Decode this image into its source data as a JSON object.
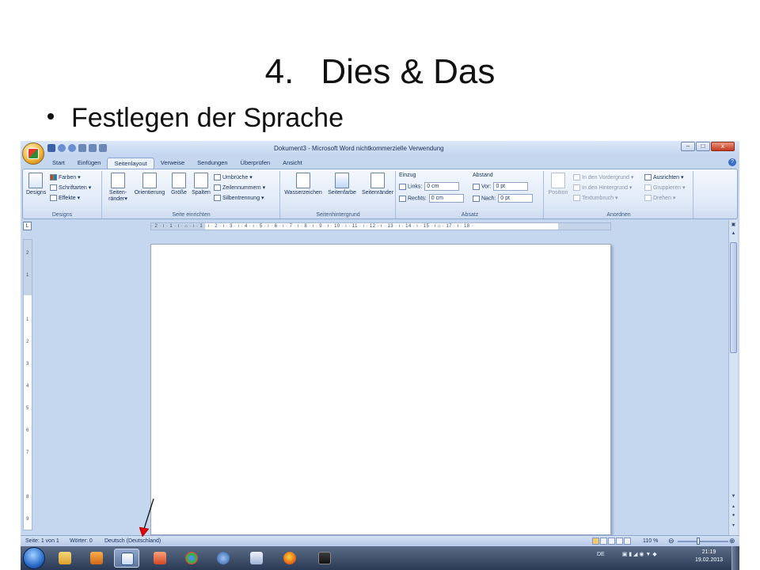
{
  "slide": {
    "title_num": "4.",
    "title_text": "Dies & Das",
    "bullet": "Festlegen der Sprache"
  },
  "window": {
    "title": "Dokument3 - Microsoft Word nichtkommerzielle Verwendung",
    "min": "–",
    "max": "□",
    "close": "x"
  },
  "tabs": [
    "Start",
    "Einfügen",
    "Seitenlayout",
    "Verweise",
    "Sendungen",
    "Überprüfen",
    "Ansicht"
  ],
  "ribbon": {
    "designs": {
      "label": "Designs",
      "designs_btn": "Designs",
      "farben": "Farben",
      "schriftarten": "Schriftarten",
      "effekte": "Effekte"
    },
    "seite_einrichten": {
      "label": "Seite einrichten",
      "seitenraender": "Seiten-",
      "seitenraender2": "ränder",
      "orientierung": "Orientierung",
      "groesse": "Größe",
      "spalten": "Spalten",
      "umbrueche": "Umbrüche",
      "zeilennummern": "Zeilennummern",
      "silbentrennung": "Silbentrennung"
    },
    "seitenhintergrund": {
      "label": "Seitenhintergrund",
      "wasserzeichen": "Wasserzeichen",
      "seitenfarbe": "Seitenfarbe",
      "seitenraender": "Seitenränder"
    },
    "absatz": {
      "label": "Absatz",
      "einzug": "Einzug",
      "links": "Links:",
      "links_val": "0 cm",
      "rechts": "Rechts:",
      "rechts_val": "0 cm",
      "abstand": "Abstand",
      "vor": "Vor:",
      "vor_val": "0 pt",
      "nach": "Nach:",
      "nach_val": "0 pt"
    },
    "anordnen": {
      "label": "Anordnen",
      "position": "Position",
      "vordergrund": "In den Vordergrund",
      "hintergrund": "In den Hintergrund",
      "textumbruch": "Textumbruch",
      "ausrichten": "Ausrichten",
      "gruppieren": "Gruppieren",
      "drehen": "Drehen"
    }
  },
  "ruler": {
    "horizontal": "· 2 · ı · 1 · ı · ⌂ · ı · 1 · ı · 2 · ı · 3 · ı · 4 · ı · 5 · ı · 6 · ı · 7 · ı · 8 · ı · 9 · ı · 10 · ı · 11 · ı · 12 · ı · 13 · ı · 14 · ı · 15 · ı ⌂ · 17 · ı · 18 ·",
    "vertical": [
      "2",
      "1",
      "1",
      "2",
      "3",
      "4",
      "5",
      "6",
      "7",
      "8",
      "9"
    ]
  },
  "statusbar": {
    "seite": "Seite: 1 von 1",
    "woerter": "Wörter: 0",
    "sprache": "Deutsch (Deutschland)",
    "zoom": "110 %"
  },
  "taskbar": {
    "lang": "DE",
    "time": "21:19",
    "date": "19.02.2013"
  },
  "colors": {
    "ribbon_bg": "#dfe9f7",
    "accent": "#2b579a",
    "annotation_arrow": "#e00000"
  }
}
